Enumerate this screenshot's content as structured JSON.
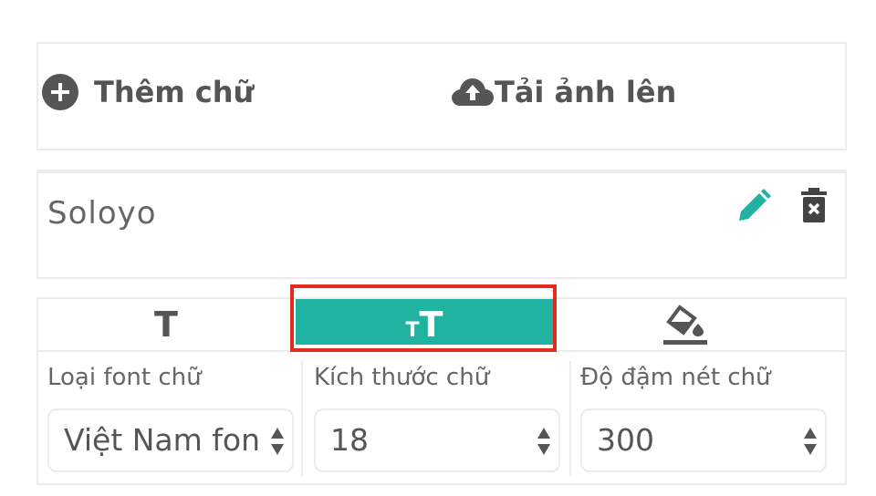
{
  "actions": {
    "add_text_label": "Thêm chữ",
    "upload_image_label": "Tải ảnh lên"
  },
  "text_item": {
    "text": "Soloyo",
    "edit_icon": "pencil-icon",
    "delete_icon": "trash-icon"
  },
  "tabs": [
    {
      "id": "font",
      "icon": "T",
      "active": false
    },
    {
      "id": "size",
      "icon": "tT",
      "active": true
    },
    {
      "id": "color",
      "icon": "paint-bucket-icon",
      "active": false
    }
  ],
  "fields": {
    "font": {
      "label": "Loại font chữ",
      "value": "Việt Nam font"
    },
    "size": {
      "label": "Kích thước chữ",
      "value": "18"
    },
    "weight": {
      "label": "Độ đậm nét chữ",
      "value": "300"
    }
  },
  "colors": {
    "accent": "#20b3a1",
    "highlight": "#e8291d",
    "text": "#555555",
    "border": "#ececec"
  }
}
